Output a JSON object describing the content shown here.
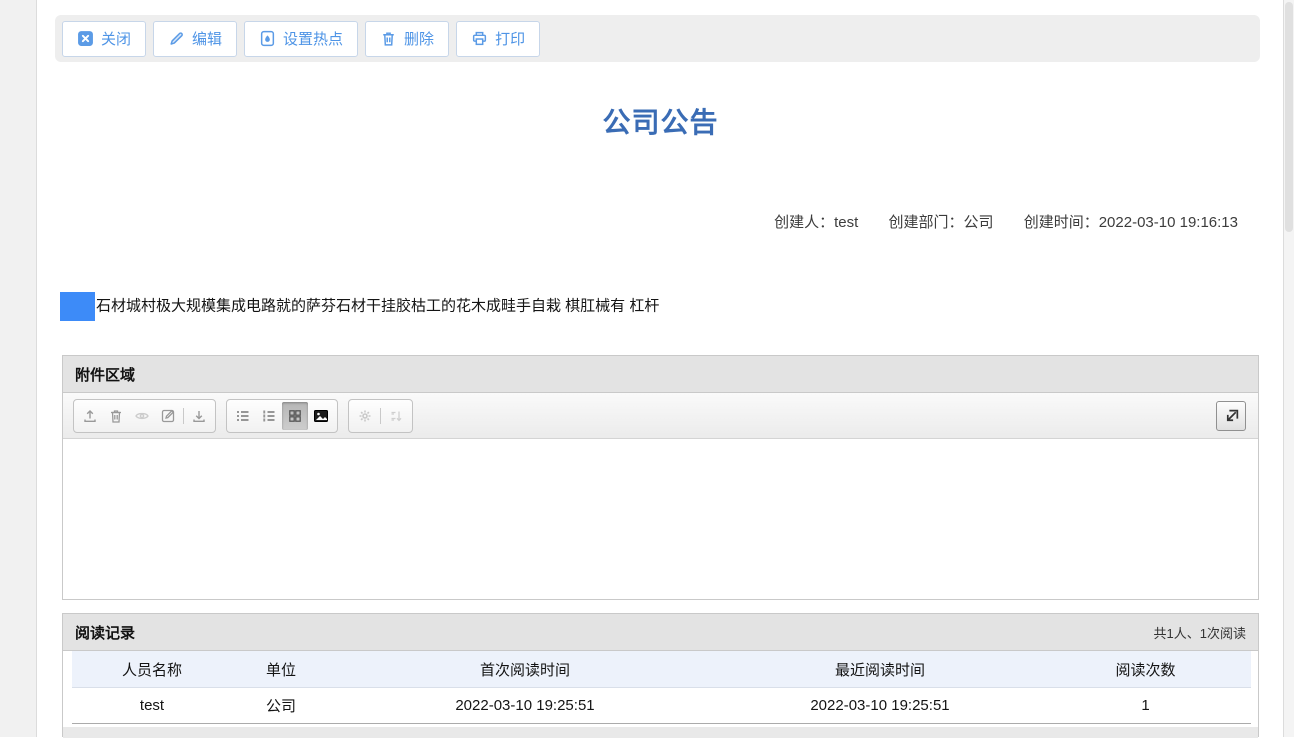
{
  "colors": {
    "accent_blue": "#4e94e6",
    "title_blue": "#3a6cb5",
    "highlight_blue": "#3d8bf8",
    "panel_header_bg": "#e3e3e3",
    "table_header_bg": "#edf2fb"
  },
  "toolbar": {
    "buttons": [
      {
        "label": "关闭",
        "icon": "close-icon"
      },
      {
        "label": "编辑",
        "icon": "edit-icon"
      },
      {
        "label": "设置热点",
        "icon": "hotspot-icon"
      },
      {
        "label": "删除",
        "icon": "delete-icon"
      },
      {
        "label": "打印",
        "icon": "print-icon"
      }
    ]
  },
  "article": {
    "title": "公司公告",
    "meta": [
      {
        "label": "创建人：",
        "value": "test"
      },
      {
        "label": "创建部门：",
        "value": "公司"
      },
      {
        "label": "创建时间：",
        "value": "2022-03-10 19:16:13"
      }
    ],
    "body": "石材城村极大规模集成电路就的萨芬石材干挂胶枯工的花木成畦手自栽 棋肛械有 杠杆"
  },
  "attachments": {
    "header": "附件区域",
    "toolbar_icons": {
      "file_group": [
        "upload-icon",
        "trash-icon",
        "preview-icon",
        "edit-file-icon",
        "download-icon"
      ],
      "view_group": [
        "bullet-list-icon",
        "numbered-list-icon",
        "grid-view-icon",
        "image-view-icon"
      ],
      "misc_group": [
        "settings-icon",
        "sort-icon"
      ],
      "right": "collapse-icon"
    }
  },
  "reading": {
    "header": "阅读记录",
    "summary": "共1人、1次阅读",
    "columns": [
      "人员名称",
      "单位",
      "首次阅读时间",
      "最近阅读时间",
      "阅读次数"
    ],
    "rows": [
      [
        "test",
        "公司",
        "2022-03-10 19:25:51",
        "2022-03-10 19:25:51",
        "1"
      ]
    ]
  }
}
